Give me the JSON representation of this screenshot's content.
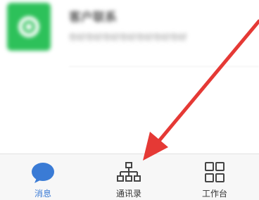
{
  "chat_list": {
    "items": [
      {
        "title": "客户联系",
        "preview": "你好你好你好你好你好你好你好",
        "avatar_color": "#2dc15a"
      }
    ]
  },
  "tabbar": {
    "tabs": [
      {
        "label": "消息",
        "icon": "chat-bubble-icon",
        "active": true
      },
      {
        "label": "通讯录",
        "icon": "org-chart-icon",
        "active": false
      },
      {
        "label": "工作台",
        "icon": "grid-icon",
        "active": false
      }
    ],
    "active_color": "#3a7bd5",
    "inactive_color": "#333333"
  },
  "annotation": {
    "color": "#e53935",
    "icon": "arrow-annotation-icon"
  }
}
